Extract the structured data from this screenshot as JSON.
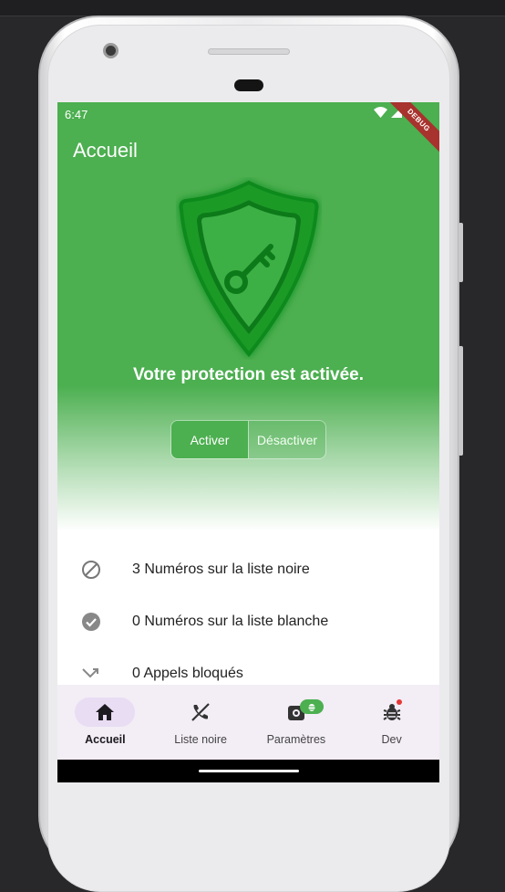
{
  "status_bar": {
    "time": "6:47",
    "debug_label": "DEBUG"
  },
  "app_bar": {
    "title": "Accueil"
  },
  "protection": {
    "status_text": "Votre protection est activée.",
    "active": true
  },
  "toggle": {
    "on_label": "Activer",
    "off_label": "Désactiver",
    "selected": "Activer"
  },
  "stats": [
    {
      "icon": "block-icon",
      "label": "3 Numéros sur la liste noire"
    },
    {
      "icon": "check-circle-icon",
      "label": "0 Numéros sur la liste blanche"
    },
    {
      "icon": "call-missed-icon",
      "label": "0 Appels bloqués"
    }
  ],
  "nav": [
    {
      "icon": "home-icon",
      "label": "Accueil",
      "active": true
    },
    {
      "icon": "phone-disabled-icon",
      "label": "Liste noire",
      "active": false
    },
    {
      "icon": "settings-icon",
      "label": "Paramètres",
      "active": false,
      "badge": "bug-icon"
    },
    {
      "icon": "bug-icon",
      "label": "Dev",
      "active": false,
      "dot": true
    }
  ],
  "colors": {
    "primary": "#4caf50",
    "nav_background": "#f3edf6",
    "nav_indicator": "#e8ddf3",
    "debug_banner": "#a8322d"
  }
}
